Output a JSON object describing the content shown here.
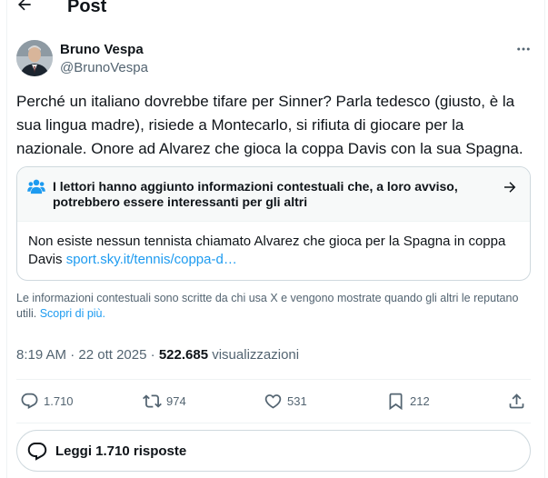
{
  "header": {
    "title": "Post",
    "back_icon": "arrow-left-icon"
  },
  "author": {
    "name": "Bruno Vespa",
    "handle": "@BrunoVespa",
    "more_icon": "more-horizontal-icon"
  },
  "tweet": {
    "text": "Perché un italiano dovrebbe tifare per Sinner? Parla tedesco (giusto, è la sua lingua madre), risiede a Montecarlo, si rifiuta di giocare per la nazionale. Onore ad Alvarez che gioca la coppa Davis con la sua Spagna."
  },
  "community_note": {
    "title": "I lettori hanno aggiunto informazioni contestuali che, a loro avviso, potrebbero essere interessanti per gli altri",
    "body": "Non esiste nessun tennista chiamato Alvarez che gioca per la Spagna in coppa Davis",
    "link": "sport.sky.it/tennis/coppa-d…"
  },
  "disclaimer": {
    "text": "Le informazioni contestuali sono scritte da chi usa X e vengono mostrate quando gli altri le reputano utili.",
    "link": "Scopri di più."
  },
  "meta": {
    "time": "8:19 AM",
    "date": "22 ott 2025",
    "separator": "·",
    "views_count": "522.685",
    "views_label": "visualizzazioni"
  },
  "actions": {
    "replies": "1.710",
    "reposts": "974",
    "likes": "531",
    "bookmarks": "212"
  },
  "read_replies": {
    "label": "Leggi 1.710 risposte"
  },
  "colors": {
    "accent": "#1d9bf0",
    "text": "#0f1419",
    "secondary": "#536471",
    "border": "#cfd9de"
  }
}
